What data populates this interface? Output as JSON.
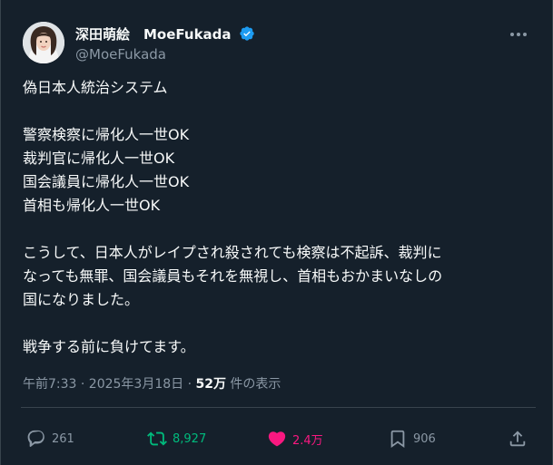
{
  "author": {
    "display_name": "深田萌絵　MoeFukada",
    "handle": "@MoeFukada",
    "verified": true,
    "avatar": "avatar-photo"
  },
  "icons": {
    "more": "more-horizontal-icon",
    "verified": "verified-badge-icon",
    "reply": "reply-icon",
    "retweet": "retweet-icon",
    "like": "heart-icon",
    "bookmark": "bookmark-icon",
    "share": "share-icon"
  },
  "tweet": {
    "lines": [
      "偽日本人統治システム",
      "",
      "警察検察に帰化人一世OK",
      "裁判官に帰化人一世OK",
      "国会議員に帰化人一世OK",
      "首相も帰化人一世OK",
      "",
      "こうして、日本人がレイプされ殺されても検察は不起訴、裁判に",
      "なっても無罪、国会議員もそれを無視し、首相もおかまいなしの",
      "国になりました。",
      "",
      "戦争する前に負けてます。"
    ],
    "timestamp": "午前7:33 · 2025年3月18日 · ",
    "views_count": "52万",
    "views_label": " 件の表示"
  },
  "actions": {
    "reply_count": "261",
    "retweet_count": "8,927",
    "like_count": "2.4万",
    "bookmark_count": "906"
  },
  "colors": {
    "background": "#15202b",
    "text": "#f7f9f9",
    "secondary": "#8b98a5",
    "verified": "#1d9bf0",
    "retweet_active": "#00ba7c",
    "like_active": "#f91880",
    "divider": "#38444d"
  }
}
